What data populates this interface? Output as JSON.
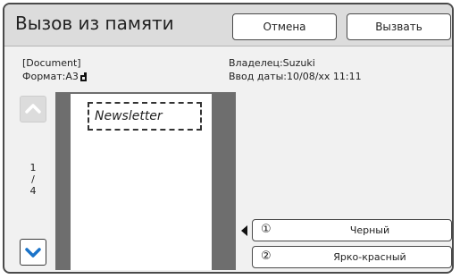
{
  "header": {
    "title": "Вызов из памяти",
    "cancel_label": "Отмена",
    "call_label": "Вызвать"
  },
  "document": {
    "name": "[Document]",
    "format": "Формат:A3",
    "owner": "Владелец:Suzuki",
    "date": "Ввод даты:10/08/xx 11:11"
  },
  "preview": {
    "text": "Newsletter"
  },
  "pager": {
    "current": "1",
    "separator": "/",
    "total": "4"
  },
  "colors": [
    {
      "number": "①",
      "label": "Черный"
    },
    {
      "number": "②",
      "label": "Ярко-красный"
    }
  ],
  "icons": {
    "up": "chevron-up-icon",
    "down": "chevron-down-icon",
    "format": "paper-orientation-icon",
    "selected": "triangle-left-icon"
  },
  "style": {
    "accent": "#1a73c9"
  }
}
